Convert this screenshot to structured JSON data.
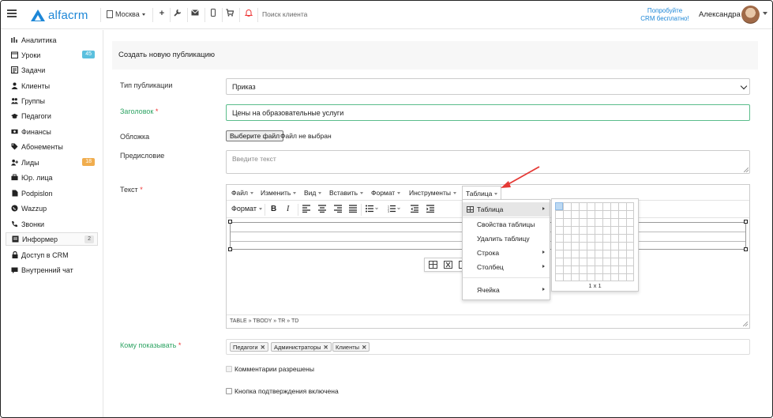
{
  "topbar": {
    "brand": "alfacrm",
    "city": "Москва",
    "search_placeholder": "Поиск клиента",
    "promo_line1": "Попробуйте",
    "promo_line2": "CRM бесплатно!",
    "user_name": "Александра"
  },
  "sidebar": {
    "items": [
      {
        "label": "Аналитика",
        "icon": "chart-icon"
      },
      {
        "label": "Уроки",
        "icon": "calendar-icon",
        "badge": "45"
      },
      {
        "label": "Задачи",
        "icon": "tasks-icon"
      },
      {
        "label": "Клиенты",
        "icon": "user-icon"
      },
      {
        "label": "Группы",
        "icon": "users-icon"
      },
      {
        "label": "Педагоги",
        "icon": "graduation-icon"
      },
      {
        "label": "Финансы",
        "icon": "money-icon"
      },
      {
        "label": "Абонементы",
        "icon": "tag-icon"
      },
      {
        "label": "Лиды",
        "icon": "user-plus-icon",
        "badge": "18"
      },
      {
        "label": "Юр. лица",
        "icon": "briefcase-icon"
      },
      {
        "label": "Podpislon",
        "icon": "file-icon"
      },
      {
        "label": "Wazzup",
        "icon": "whatsapp-icon"
      },
      {
        "label": "Звонки",
        "icon": "phone-icon"
      },
      {
        "label": "Информер",
        "icon": "newspaper-icon",
        "badge": "2"
      },
      {
        "label": "Доступ в CRM",
        "icon": "lock-icon"
      },
      {
        "label": "Внутренний чат",
        "icon": "chat-icon"
      }
    ],
    "badge_colors": {
      "Уроки": "#5bc0de",
      "Лиды": "#f0ad4e",
      "Информер": "#e6e6e6"
    }
  },
  "form": {
    "title": "Создать новую публикацию",
    "type_label": "Тип публикации",
    "type_value": "Приказ",
    "headline_label": "Заголовок",
    "headline_value": "Цены на образовательные услуги",
    "cover_label": "Обложка",
    "file_button": "Выберите файл",
    "file_status": "Файл не выбран",
    "preface_label": "Предисловие",
    "preface_placeholder": "Введите текст",
    "text_label": "Текст",
    "audience_label": "Кому показывать",
    "audience_tags": [
      "Педагоги",
      "Администраторы",
      "Клиенты"
    ],
    "comments_label": "Комментарии разрешены",
    "confirm_label": "Кнопка подтверждения включена"
  },
  "editor": {
    "menu": [
      "Файл",
      "Изменить",
      "Вид",
      "Вставить",
      "Формат",
      "Инструменты",
      "Таблица"
    ],
    "format_label": "Формат",
    "bold": "B",
    "italic": "I",
    "statusbar": "TABLE » TBODY » TR » TD"
  },
  "table_menu": {
    "items": [
      {
        "label": "Таблица",
        "submenu": true
      },
      {
        "label": "Свойства таблицы",
        "submenu": false
      },
      {
        "label": "Удалить таблицу",
        "submenu": false
      },
      {
        "label": "Строка",
        "submenu": true
      },
      {
        "label": "Столбец",
        "submenu": true
      },
      {
        "label": "Ячейка",
        "submenu": true
      }
    ],
    "grid_size": "1 x 1"
  },
  "colors": {
    "brand": "#1d87d7",
    "required_label": "#2fa464",
    "required_star": "#e33333",
    "annotation_arrow": "#e53935"
  }
}
